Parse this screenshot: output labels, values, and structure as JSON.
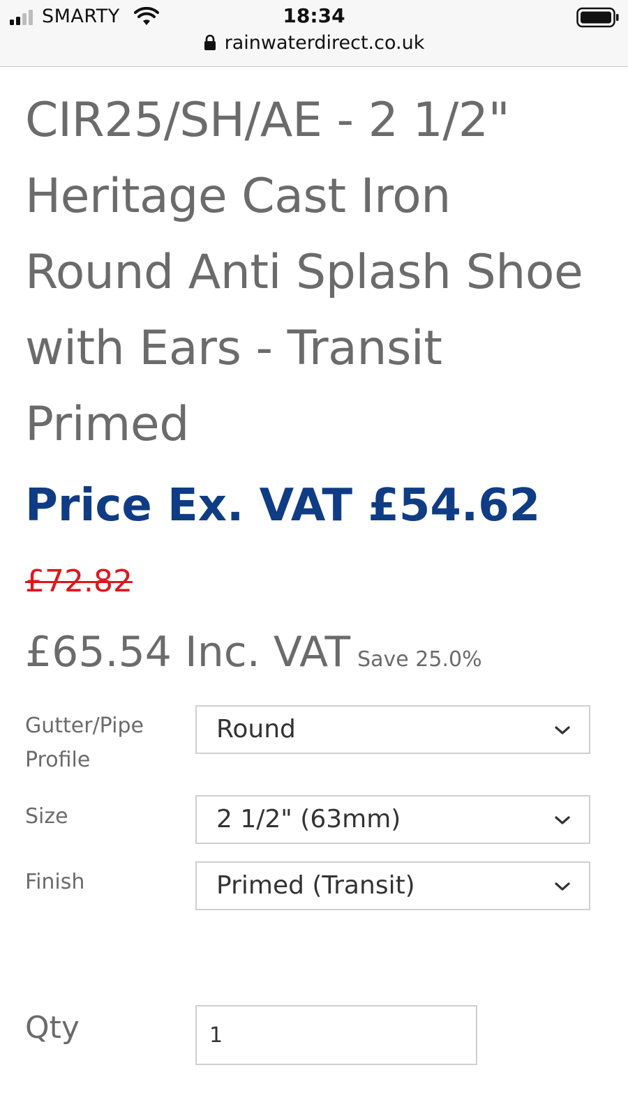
{
  "status_bar": {
    "carrier": "SMARTY",
    "time": "18:34",
    "url": "rainwaterdirect.co.uk",
    "icons": [
      "signal-icon",
      "wifi-icon",
      "lock-icon",
      "battery-icon"
    ]
  },
  "product": {
    "title": "CIR25/SH/AE - 2 1/2\" Heritage Cast Iron Round Anti Splash Shoe with Ears - Transit Primed",
    "price_ex_vat": "Price Ex. VAT £54.62",
    "was_price": "£72.82",
    "price_inc_vat": "£65.54 Inc. VAT",
    "save_text": "Save 25.0%"
  },
  "options": [
    {
      "label": "Gutter/Pipe Profile",
      "value": "Round"
    },
    {
      "label": "Size",
      "value": "2 1/2\" (63mm)"
    },
    {
      "label": "Finish",
      "value": "Primed (Transit)"
    }
  ],
  "quantity": {
    "label": "Qty",
    "value": "1"
  },
  "colors": {
    "title_grey": "#6b6b6b",
    "price_blue": "#0f3c84",
    "was_red": "#e0161e",
    "border": "#cfcfcf"
  }
}
